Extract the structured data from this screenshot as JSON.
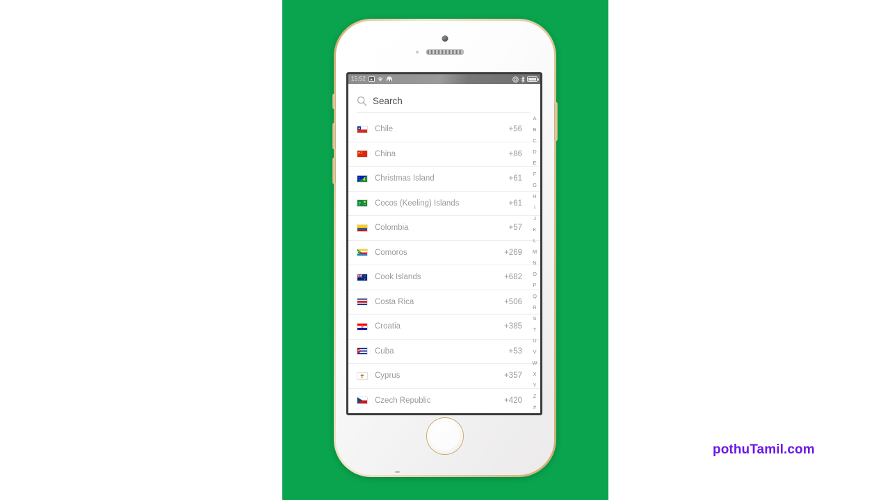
{
  "background": {
    "color": "#0aa44e"
  },
  "watermark": {
    "text": "pothuTamil.com",
    "color": "#6a18e8"
  },
  "device": {
    "name": "iphone-white-gold",
    "buttons": {
      "silent": "silent-switch",
      "volume_up": "volume-up-button",
      "volume_down": "volume-down-button",
      "power": "power-button",
      "home": "home-button"
    }
  },
  "status_bar": {
    "time": "15:52",
    "left_icons": [
      "photos-icon",
      "wifi-icon",
      "vpn-icon"
    ],
    "right_icons": [
      "do-not-disturb-icon",
      "bluetooth-icon",
      "battery-icon"
    ]
  },
  "search": {
    "placeholder": "Search",
    "icon": "search-icon",
    "value": ""
  },
  "list": {
    "columns": [
      "flag",
      "country",
      "dial_code"
    ],
    "rows": [
      {
        "country": "Chile",
        "dial_code": "+56",
        "flag": "cl"
      },
      {
        "country": "China",
        "dial_code": "+86",
        "flag": "cn"
      },
      {
        "country": "Christmas Island",
        "dial_code": "+61",
        "flag": "cx"
      },
      {
        "country": "Cocos (Keeling) Islands",
        "dial_code": "+61",
        "flag": "cc"
      },
      {
        "country": "Colombia",
        "dial_code": "+57",
        "flag": "co"
      },
      {
        "country": "Comoros",
        "dial_code": "+269",
        "flag": "km"
      },
      {
        "country": "Cook Islands",
        "dial_code": "+682",
        "flag": "ck"
      },
      {
        "country": "Costa Rica",
        "dial_code": "+506",
        "flag": "cr"
      },
      {
        "country": "Croatia",
        "dial_code": "+385",
        "flag": "hr"
      },
      {
        "country": "Cuba",
        "dial_code": "+53",
        "flag": "cu"
      },
      {
        "country": "Cyprus",
        "dial_code": "+357",
        "flag": "cy"
      },
      {
        "country": "Czech Republic",
        "dial_code": "+420",
        "flag": "cz"
      }
    ]
  },
  "alpha_index": {
    "letters": [
      "A",
      "B",
      "C",
      "D",
      "E",
      "F",
      "G",
      "H",
      "I",
      "J",
      "K",
      "L",
      "M",
      "N",
      "O",
      "P",
      "Q",
      "R",
      "S",
      "T",
      "U",
      "V",
      "W",
      "X",
      "Y",
      "Z",
      "#"
    ]
  }
}
